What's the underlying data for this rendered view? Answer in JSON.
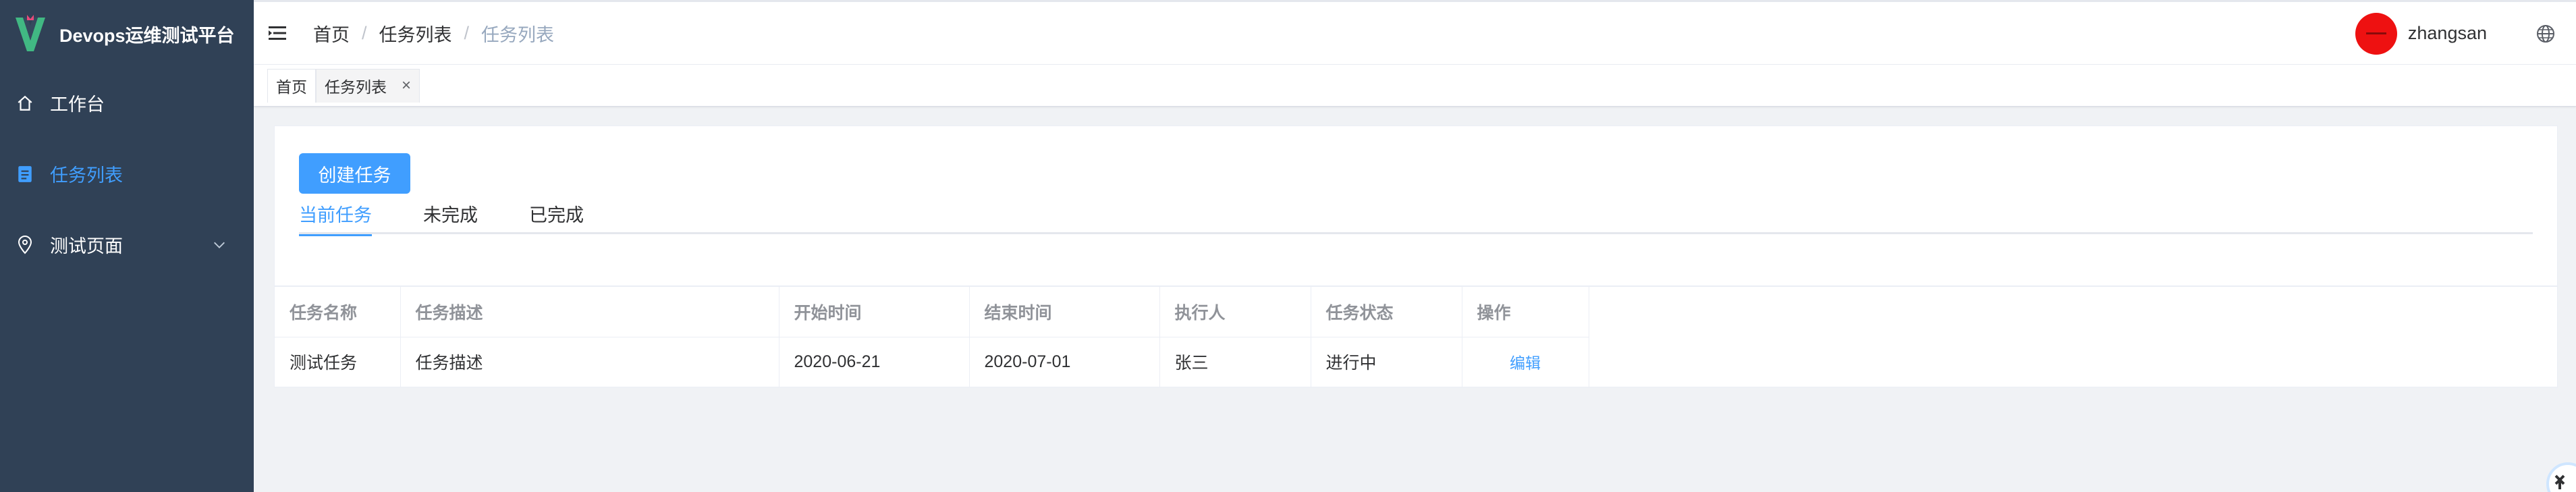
{
  "app": {
    "title": "Devops运维测试平台"
  },
  "sidebar": {
    "items": [
      {
        "label": "工作台",
        "icon": "home-icon"
      },
      {
        "label": "任务列表",
        "icon": "document-icon",
        "active": true
      },
      {
        "label": "测试页面",
        "icon": "location-icon",
        "has_submenu": true
      }
    ]
  },
  "breadcrumb": [
    "首页",
    "任务列表",
    "任务列表"
  ],
  "user": {
    "name": "zhangsan"
  },
  "tags": [
    {
      "label": "首页"
    },
    {
      "label": "任务列表",
      "closable": true,
      "active": true
    }
  ],
  "main": {
    "create_button": "创建任务",
    "tabs": [
      {
        "label": "当前任务",
        "active": true
      },
      {
        "label": "未完成"
      },
      {
        "label": "已完成"
      }
    ]
  },
  "table": {
    "columns": [
      "任务名称",
      "任务描述",
      "开始时间",
      "结束时间",
      "执行人",
      "任务状态",
      "操作"
    ],
    "rows": [
      [
        "测试任务",
        "任务描述",
        "2020-06-21",
        "2020-07-01",
        "张三",
        "进行中",
        "编辑"
      ]
    ]
  },
  "colors": {
    "sidebar_bg": "#304156",
    "accent": "#409eff",
    "avatar": "#ee1111"
  }
}
